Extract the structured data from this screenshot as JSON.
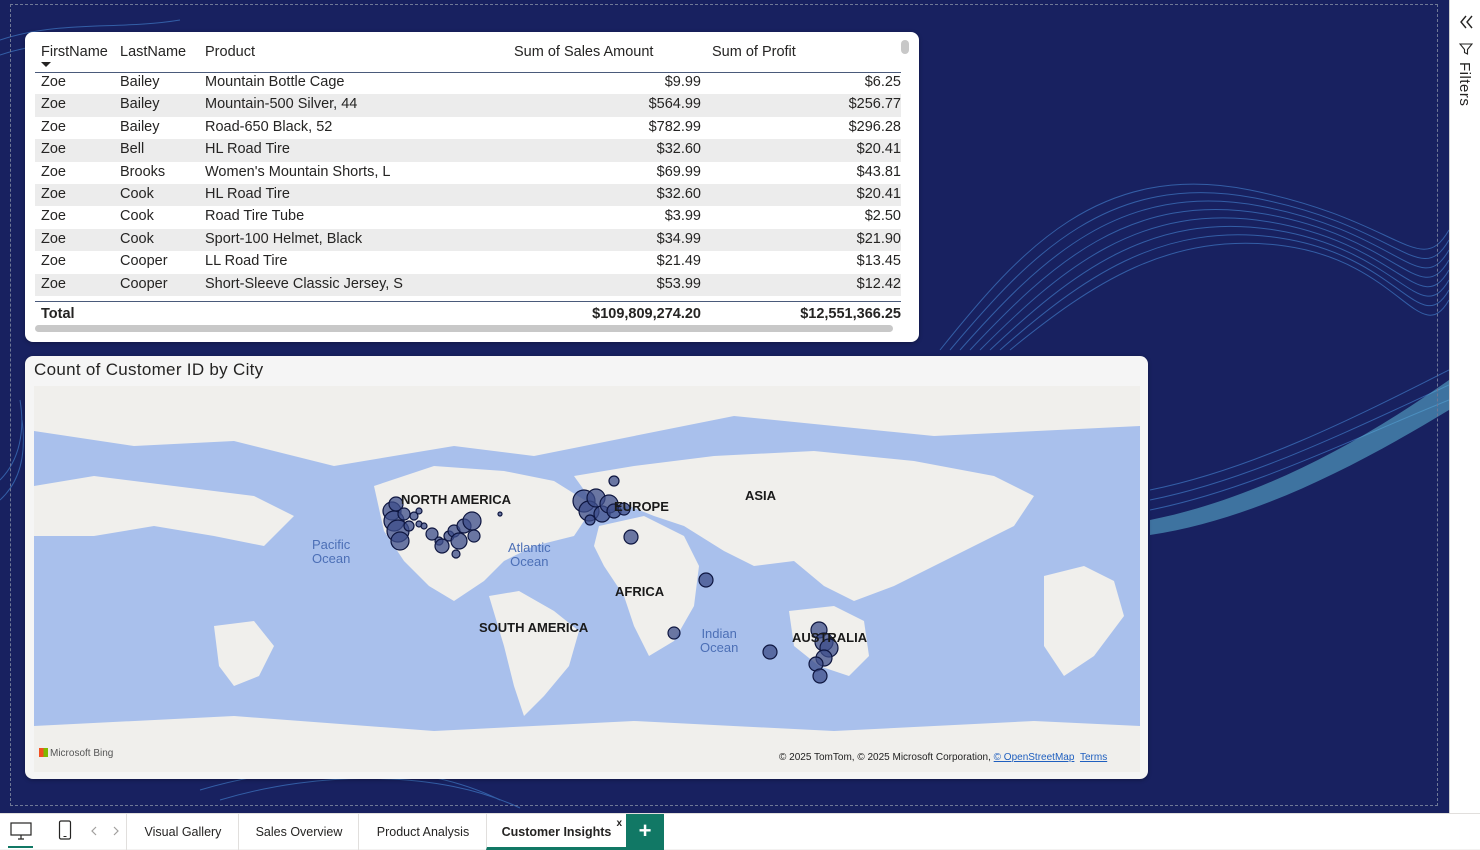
{
  "filters_pane": {
    "label": "Filters",
    "collapse_icon": "chevrons-left-icon",
    "filter_icon": "funnel-icon"
  },
  "table": {
    "columns": [
      "FirstName",
      "LastName",
      "Product",
      "Sum of Sales Amount",
      "Sum of Profit"
    ],
    "rows": [
      [
        "Zoe",
        "Bailey",
        "Mountain Bottle Cage",
        "$9.99",
        "$6.25"
      ],
      [
        "Zoe",
        "Bailey",
        "Mountain-500 Silver, 44",
        "$564.99",
        "$256.77"
      ],
      [
        "Zoe",
        "Bailey",
        "Road-650 Black, 52",
        "$782.99",
        "$296.28"
      ],
      [
        "Zoe",
        "Bell",
        "HL Road Tire",
        "$32.60",
        "$20.41"
      ],
      [
        "Zoe",
        "Brooks",
        "Women's Mountain Shorts, L",
        "$69.99",
        "$43.81"
      ],
      [
        "Zoe",
        "Cook",
        "HL Road Tire",
        "$32.60",
        "$20.41"
      ],
      [
        "Zoe",
        "Cook",
        "Road Tire Tube",
        "$3.99",
        "$2.50"
      ],
      [
        "Zoe",
        "Cook",
        "Sport-100 Helmet, Black",
        "$34.99",
        "$21.90"
      ],
      [
        "Zoe",
        "Cooper",
        "LL Road Tire",
        "$21.49",
        "$13.45"
      ],
      [
        "Zoe",
        "Cooper",
        "Short-Sleeve Classic Jersey, S",
        "$53.99",
        "$12.42"
      ]
    ],
    "total": {
      "label": "Total",
      "sales": "$109,809,274.20",
      "profit": "$12,551,366.25"
    }
  },
  "map": {
    "title": "Count of Customer ID by City",
    "continents": [
      "NORTH AMERICA",
      "EUROPE",
      "ASIA",
      "AFRICA",
      "SOUTH AMERICA",
      "AUSTRALIA"
    ],
    "oceans": [
      {
        "line1": "Pacific",
        "line2": "Ocean"
      },
      {
        "line1": "Atlantic",
        "line2": "Ocean"
      },
      {
        "line1": "Indian",
        "line2": "Ocean"
      }
    ],
    "bing_logo": "Microsoft Bing",
    "attribution": "© 2025 TomTom, © 2025 Microsoft Corporation,",
    "osm_link": "© OpenStreetMap",
    "terms_link": "Terms",
    "bubble_color": "#3d4d8a"
  },
  "tabs": [
    {
      "label": "Visual Gallery",
      "active": false
    },
    {
      "label": "Sales Overview",
      "active": false
    },
    {
      "label": "Product Analysis",
      "active": false
    },
    {
      "label": "Customer Insights",
      "active": true
    }
  ],
  "tab_close": "x",
  "add_tab": "+",
  "accent_color": "#117865",
  "canvas_color": "#182160"
}
